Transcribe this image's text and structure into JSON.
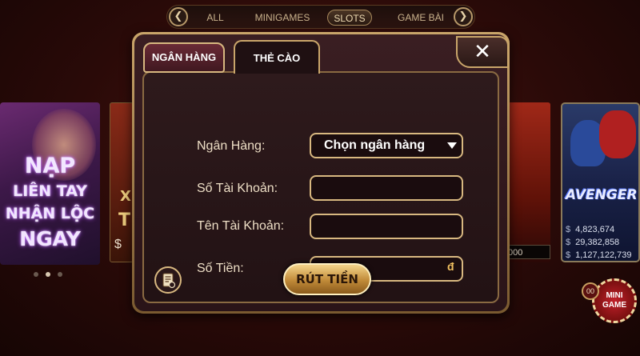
{
  "top_nav": {
    "tabs": [
      "ALL",
      "MINIGAMES",
      "SLOTS",
      "GAME BÀI"
    ],
    "active_tab": "SLOTS",
    "left_arrow": "❮",
    "right_arrow": "❯"
  },
  "banner": {
    "lines": [
      "NẠP",
      "LIÊN TAY",
      "NHẬN LỘC",
      "NGAY"
    ],
    "dots_active_index": 1
  },
  "tile_left_partial": {
    "text": "X",
    "text2": "T",
    "amount_symbol": "$"
  },
  "tile_right_partial": {
    "amount": "000"
  },
  "tile_avengers": {
    "logo": "AVENGER",
    "jackpots": [
      {
        "symbol": "$",
        "value": "4,823,674"
      },
      {
        "symbol": "$",
        "value": "29,382,858"
      },
      {
        "symbol": "$",
        "value": "1,127,122,739"
      }
    ]
  },
  "mini_game": {
    "label_line1": "MINI",
    "label_line2": "GAME",
    "count": "00"
  },
  "dialog": {
    "tabs": {
      "bank": "NGÂN HÀNG",
      "card": "THẺ CÀO"
    },
    "active_tab": "bank",
    "close_glyph": "✕",
    "fields": {
      "bank_label": "Ngân Hàng:",
      "bank_select_value": "Chọn ngân hàng",
      "account_number_label": "Số Tài Khoản:",
      "account_number_value": "",
      "account_name_label": "Tên Tài Khoản:",
      "account_name_value": "",
      "amount_label": "Số Tiền:",
      "amount_value": "",
      "currency_symbol": "đ"
    },
    "submit_label": "RÚT TIỀN",
    "history_icon": "history-icon"
  },
  "colors": {
    "accent_gold": "#c9a56a",
    "dialog_bg": "#2a1418",
    "button_gold": "#e0b060"
  }
}
